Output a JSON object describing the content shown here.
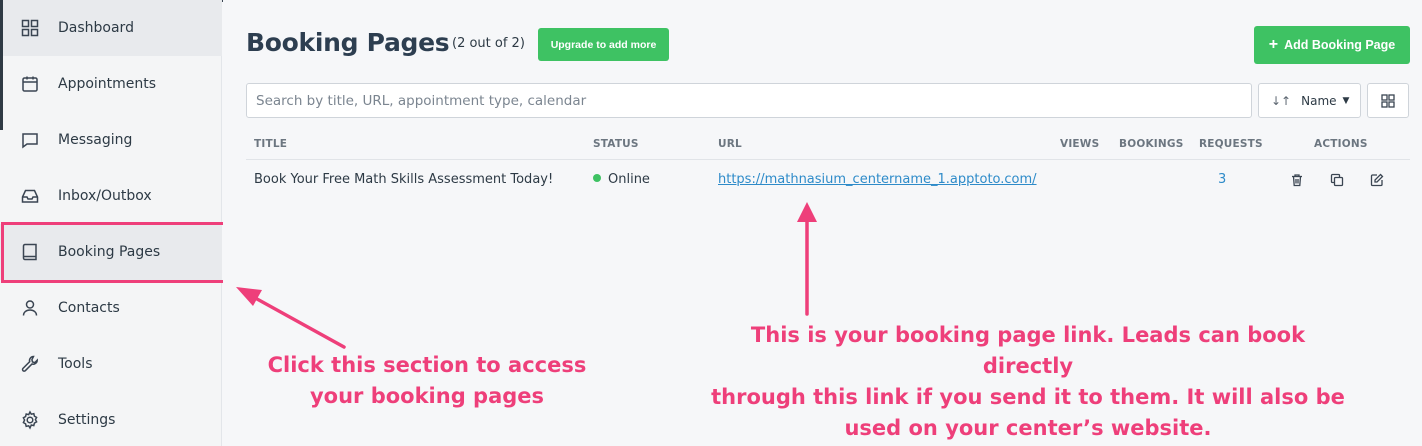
{
  "sidebar": {
    "items": [
      {
        "label": "Dashboard",
        "icon": "dashboard-icon"
      },
      {
        "label": "Appointments",
        "icon": "calendar-icon"
      },
      {
        "label": "Messaging",
        "icon": "message-icon"
      },
      {
        "label": "Inbox/Outbox",
        "icon": "inbox-icon"
      },
      {
        "label": "Booking Pages",
        "icon": "book-icon"
      },
      {
        "label": "Contacts",
        "icon": "person-icon"
      },
      {
        "label": "Tools",
        "icon": "wrench-icon"
      },
      {
        "label": "Settings",
        "icon": "gear-icon"
      }
    ]
  },
  "header": {
    "title": "Booking Pages",
    "count": "(2 out of 2)",
    "upgrade_label": "Upgrade to add more",
    "add_label": "Add Booking Page"
  },
  "search": {
    "placeholder": "Search by title, URL, appointment type, calendar"
  },
  "sort": {
    "label": "Name"
  },
  "table": {
    "columns": [
      "TITLE",
      "STATUS",
      "URL",
      "VIEWS",
      "BOOKINGS",
      "REQUESTS",
      "ACTIONS"
    ],
    "rows": [
      {
        "title": "Book Your Free Math Skills Assessment Today!",
        "status": "Online",
        "url": "https://mathnasium_centername_1.apptoto.com/",
        "views": "",
        "bookings": "",
        "requests": "3"
      }
    ]
  },
  "annotations": {
    "left_line1": "Click this section to access",
    "left_line2": "your booking pages",
    "right_line1": "This is your booking page link. Leads can book directly",
    "right_line2": "through this link if you send it to them. It will also be",
    "right_line3": "used on your center’s website."
  },
  "colors": {
    "accent_green": "#3ec263",
    "annotation_pink": "#ee3f7a",
    "link_blue": "#2e8bc9",
    "title_dark": "#2d3e50"
  }
}
